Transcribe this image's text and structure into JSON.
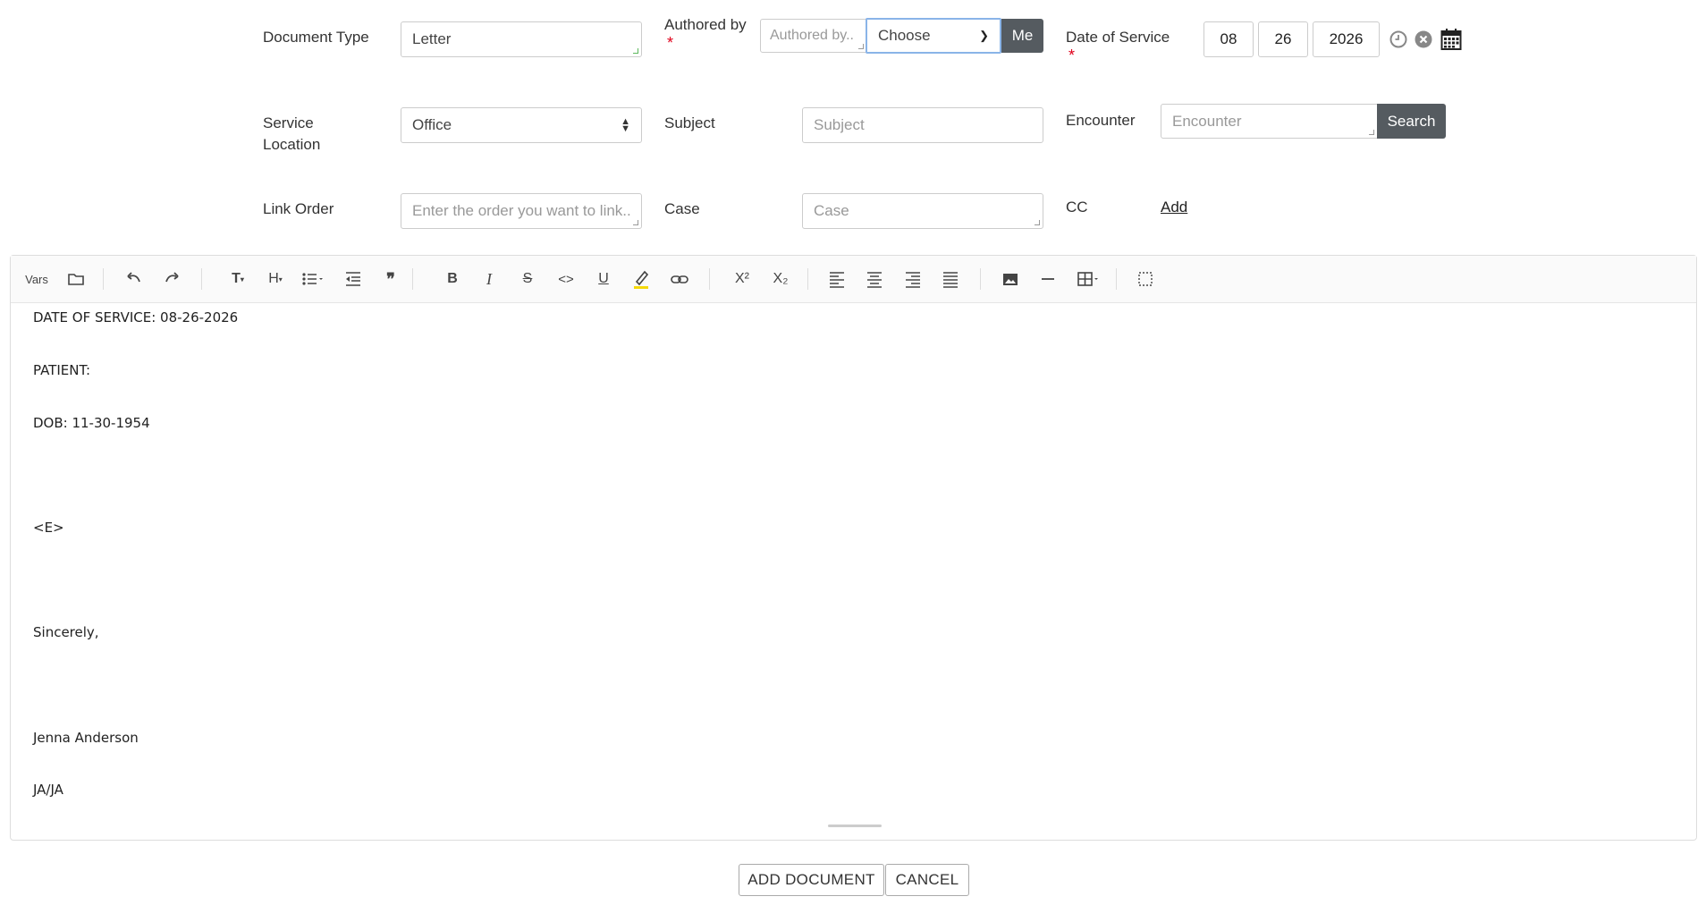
{
  "form": {
    "document_type": {
      "label": "Document Type",
      "value": "Letter"
    },
    "authored_by": {
      "label": "Authored by",
      "required": "*",
      "placeholder": "Authored by..",
      "select_value": "Choose",
      "me_button": "Me"
    },
    "date_of_service": {
      "label": "Date of Service",
      "required": "*",
      "month": "08",
      "day": "26",
      "year": "2026"
    },
    "service_location": {
      "label_line1": "Service",
      "label_line2": "Location",
      "value": "Office"
    },
    "subject": {
      "label": "Subject",
      "placeholder": "Subject"
    },
    "encounter": {
      "label": "Encounter",
      "placeholder": "Encounter",
      "search_button": "Search"
    },
    "link_order": {
      "label": "Link Order",
      "placeholder": "Enter the order you want to link..."
    },
    "case": {
      "label": "Case",
      "placeholder": "Case"
    },
    "cc": {
      "label": "CC",
      "add_link": "Add"
    }
  },
  "toolbar": {
    "vars": "Vars",
    "icons": [
      "folder-icon",
      "undo-icon",
      "redo-icon",
      "text-style-icon",
      "heading-icon",
      "list-icon",
      "outdent-icon",
      "quote-icon",
      "bold-icon",
      "italic-icon",
      "strikethrough-icon",
      "code-icon",
      "underline-icon",
      "highlight-icon",
      "link-icon",
      "superscript-icon",
      "subscript-icon",
      "align-left-icon",
      "align-center-icon",
      "align-right-icon",
      "align-justify-icon",
      "image-icon",
      "horizontal-rule-icon",
      "table-icon",
      "select-all-icon"
    ],
    "glyphs": {
      "bold": "B",
      "italic": "I",
      "underline": "U",
      "strike": "S",
      "code": "<>",
      "heading": "H",
      "text": "T",
      "superscript": "X²",
      "subscript": "X₂",
      "quote": "❞"
    }
  },
  "editor": {
    "lines": [
      "DATE OF SERVICE: 08-26-2026",
      "PATIENT:",
      "DOB: 11-30-1954",
      "<E>",
      "Sincerely,",
      "Jenna Anderson",
      "JA/JA"
    ]
  },
  "actions": {
    "add_document": "ADD DOCUMENT",
    "cancel": "CANCEL"
  },
  "colors": {
    "accent_dark": "#555b60",
    "required": "#e0001b",
    "highlight": "#f5d90a"
  }
}
